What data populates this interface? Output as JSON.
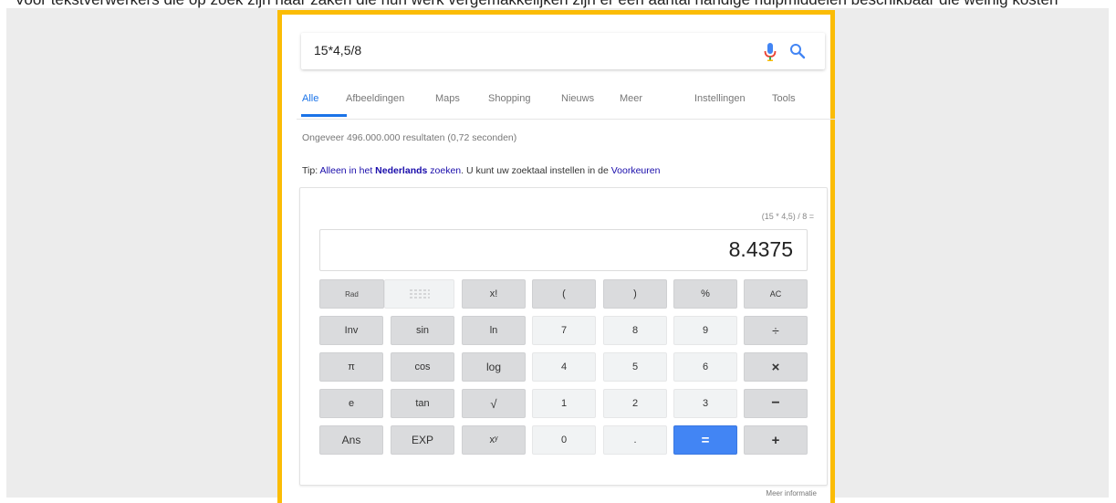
{
  "top_caption": "Voor tekstverwerkers die op zoek zijn naar zaken die hun werk vergemakkelijken zijn er een aantal handige hulpmiddelen beschikbaar die weinig kosten",
  "search": {
    "query": "15*4,5/8",
    "mic_icon": "mic-icon",
    "search_icon": "search-icon"
  },
  "tabs": {
    "all": "Alle",
    "images": "Afbeeldingen",
    "maps": "Maps",
    "shopping": "Shopping",
    "news": "Nieuws",
    "more": "Meer",
    "settings": "Instellingen",
    "tools": "Tools"
  },
  "results": {
    "stats": "Ongeveer 496.000.000 resultaten (0,72 seconden)"
  },
  "tip": {
    "prefix": "Tip: ",
    "link1": "Alleen in het ",
    "bold": "Nederlands",
    "link2": " zoeken",
    "middle": ". U kunt uw zoektaal instellen in de ",
    "link3": "Voorkeuren"
  },
  "calculator": {
    "expression": "(15 * 4,5) / 8 =",
    "result": "8.4375",
    "keys": {
      "rad": "Rad",
      "fact": "x!",
      "open": "(",
      "close": ")",
      "percent": "%",
      "ac": "AC",
      "inv": "Inv",
      "sin": "sin",
      "ln": "ln",
      "seven": "7",
      "eight": "8",
      "nine": "9",
      "divide": "÷",
      "pi": "π",
      "cos": "cos",
      "log": "log",
      "four": "4",
      "five": "5",
      "six": "6",
      "multiply": "×",
      "e": "e",
      "tan": "tan",
      "sqrt": "√",
      "one": "1",
      "two": "2",
      "three": "3",
      "minus": "−",
      "ans": "Ans",
      "exp": "EXP",
      "power": "xʸ",
      "zero": "0",
      "dot": ".",
      "equals": "=",
      "plus": "+"
    }
  },
  "more_info": "Meer informatie",
  "colors": {
    "frame": "#fbbc05",
    "accent_blue": "#4285f4",
    "link": "#1a0dab"
  }
}
